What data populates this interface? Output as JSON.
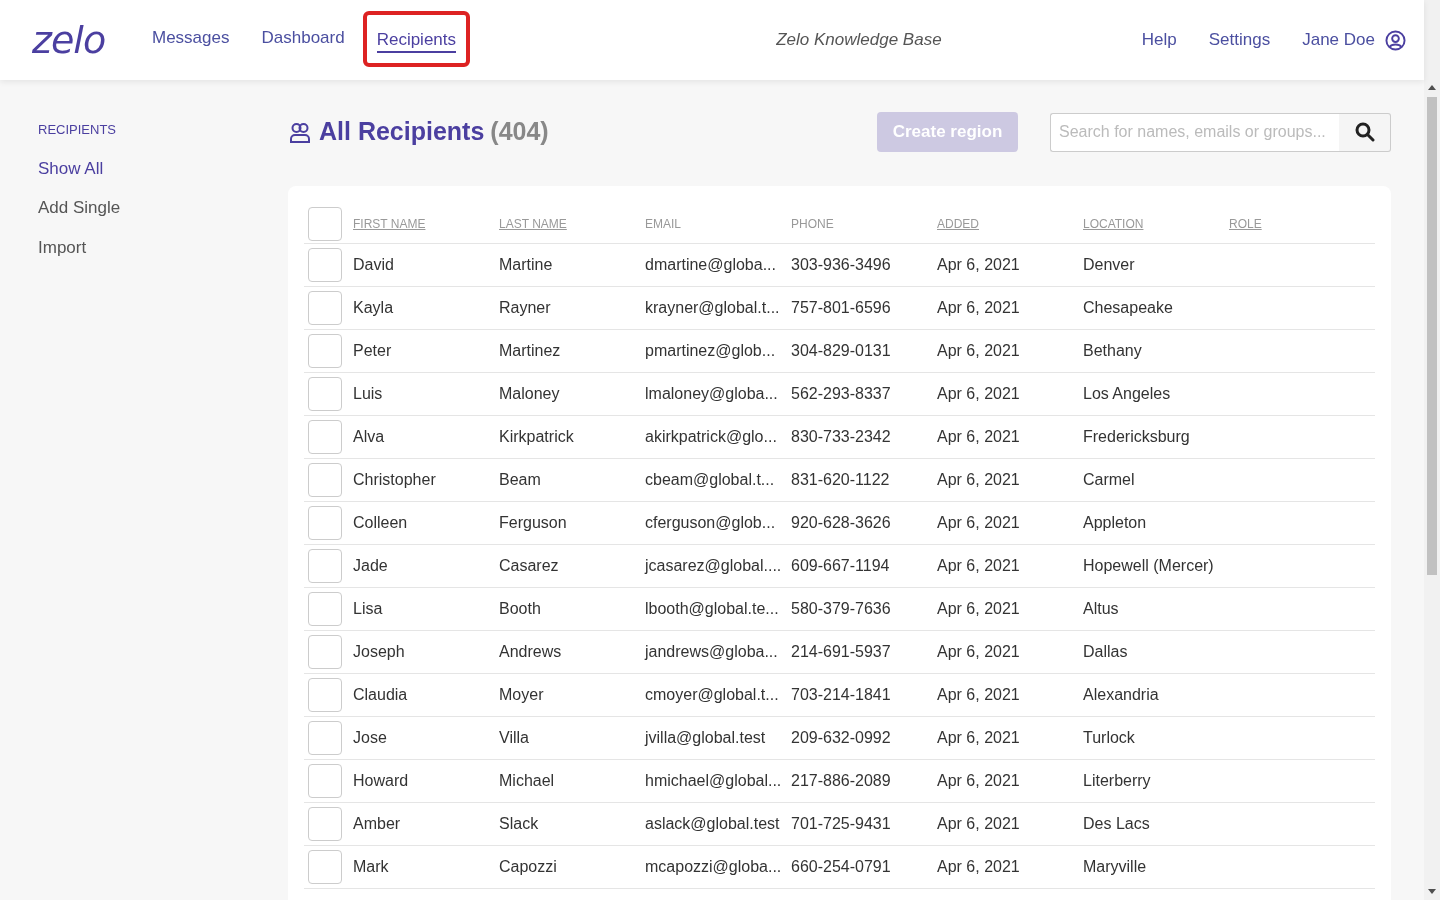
{
  "nav": {
    "logo": "zelo",
    "links": [
      {
        "label": "Messages",
        "selected": false
      },
      {
        "label": "Dashboard",
        "selected": false
      },
      {
        "label": "Recipients",
        "selected": true,
        "highlighted": true
      }
    ],
    "center": "Zelo Knowledge Base",
    "right_links": [
      "Help",
      "Settings"
    ],
    "user": "Jane Doe"
  },
  "sidebar": {
    "heading": "RECIPIENTS",
    "items": [
      "Show All",
      "Add Single",
      "Import"
    ]
  },
  "header": {
    "title": "All Recipients",
    "count": "(404)",
    "button": {
      "label": "Create region",
      "disabled": true
    },
    "search": {
      "placeholder": "Search for names, emails or groups..."
    }
  },
  "table": {
    "select_all": {
      "checked": false
    },
    "columns": [
      {
        "label": "FIRST NAME",
        "sortable": true
      },
      {
        "label": "LAST NAME",
        "sortable": true
      },
      {
        "label": "EMAIL",
        "sortable": false
      },
      {
        "label": "PHONE",
        "sortable": false
      },
      {
        "label": "ADDED",
        "sortable": true
      },
      {
        "label": "LOCATION",
        "sortable": true
      },
      {
        "label": "ROLE",
        "sortable": true
      }
    ],
    "rows": [
      {
        "checked": false,
        "cells": [
          "David",
          "Martine",
          "dmartine@globa...",
          "303-936-3496",
          "Apr 6, 2021",
          "Denver"
        ]
      },
      {
        "checked": false,
        "cells": [
          "Kayla",
          "Rayner",
          "krayner@global.t...",
          "757-801-6596",
          "Apr 6, 2021",
          "Chesapeake"
        ]
      },
      {
        "checked": false,
        "cells": [
          "Peter",
          "Martinez",
          "pmartinez@glob...",
          "304-829-0131",
          "Apr 6, 2021",
          "Bethany"
        ]
      },
      {
        "checked": false,
        "cells": [
          "Luis",
          "Maloney",
          "lmaloney@globa...",
          "562-293-8337",
          "Apr 6, 2021",
          "Los Angeles"
        ]
      },
      {
        "checked": false,
        "cells": [
          "Alva",
          "Kirkpatrick",
          "akirkpatrick@glo...",
          "830-733-2342",
          "Apr 6, 2021",
          "Fredericksburg"
        ]
      },
      {
        "checked": false,
        "cells": [
          "Christopher",
          "Beam",
          "cbeam@global.t...",
          "831-620-1122",
          "Apr 6, 2021",
          "Carmel"
        ]
      },
      {
        "checked": false,
        "cells": [
          "Colleen",
          "Ferguson",
          "cferguson@glob...",
          "920-628-3626",
          "Apr 6, 2021",
          "Appleton"
        ]
      },
      {
        "checked": false,
        "cells": [
          "Jade",
          "Casarez",
          "jcasarez@global....",
          "609-667-1194",
          "Apr 6, 2021",
          "Hopewell (Mercer)"
        ]
      },
      {
        "checked": false,
        "cells": [
          "Lisa",
          "Booth",
          "lbooth@global.te...",
          "580-379-7636",
          "Apr 6, 2021",
          "Altus"
        ]
      },
      {
        "checked": false,
        "cells": [
          "Joseph",
          "Andrews",
          "jandrews@globa...",
          "214-691-5937",
          "Apr 6, 2021",
          "Dallas"
        ]
      },
      {
        "checked": false,
        "cells": [
          "Claudia",
          "Moyer",
          "cmoyer@global.t...",
          "703-214-1841",
          "Apr 6, 2021",
          "Alexandria"
        ]
      },
      {
        "checked": false,
        "cells": [
          "Jose",
          "Villa",
          "jvilla@global.test",
          "209-632-0992",
          "Apr 6, 2021",
          "Turlock"
        ]
      },
      {
        "checked": false,
        "cells": [
          "Howard",
          "Michael",
          "hmichael@global...",
          "217-886-2089",
          "Apr 6, 2021",
          "Literberry"
        ]
      },
      {
        "checked": false,
        "cells": [
          "Amber",
          "Slack",
          "aslack@global.test",
          "701-725-9431",
          "Apr 6, 2021",
          "Des Lacs"
        ]
      },
      {
        "checked": false,
        "cells": [
          "Mark",
          "Capozzi",
          "mcapozzi@globa...",
          "660-254-0791",
          "Apr 6, 2021",
          "Maryville"
        ]
      }
    ]
  }
}
